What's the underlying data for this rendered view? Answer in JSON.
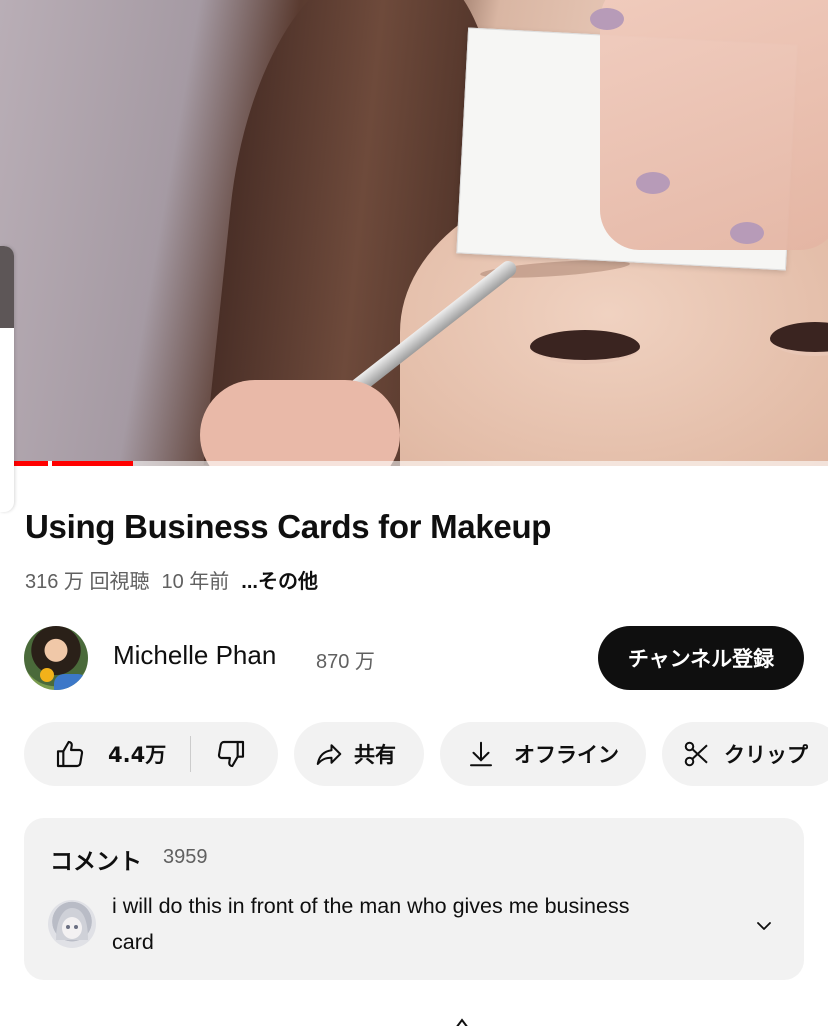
{
  "video": {
    "title": "Using Business Cards for Makeup",
    "views": "316 万 回視聴",
    "age": "10 年前",
    "more": "...その他",
    "progress_percent": 14.6
  },
  "channel": {
    "name": "Michelle Phan",
    "subscribers": "870 万",
    "subscribe_label": "チャンネル登録"
  },
  "actions": {
    "likes": "4.4万",
    "share": "共有",
    "offline": "オフライン",
    "clip": "クリップ"
  },
  "comments": {
    "title": "コメント",
    "count": "3959",
    "top_comment": "i will do this in front of the man who gives me business card"
  },
  "colors": {
    "accent": "#ff0000",
    "subscribe_bg": "#0f0f0f",
    "pill_bg": "#f2f2f2"
  },
  "icons": {
    "like": "thumbs-up-icon",
    "dislike": "thumbs-down-icon",
    "share": "share-arrow-icon",
    "offline": "download-icon",
    "clip": "scissors-icon",
    "expand": "chevron-down-icon"
  }
}
